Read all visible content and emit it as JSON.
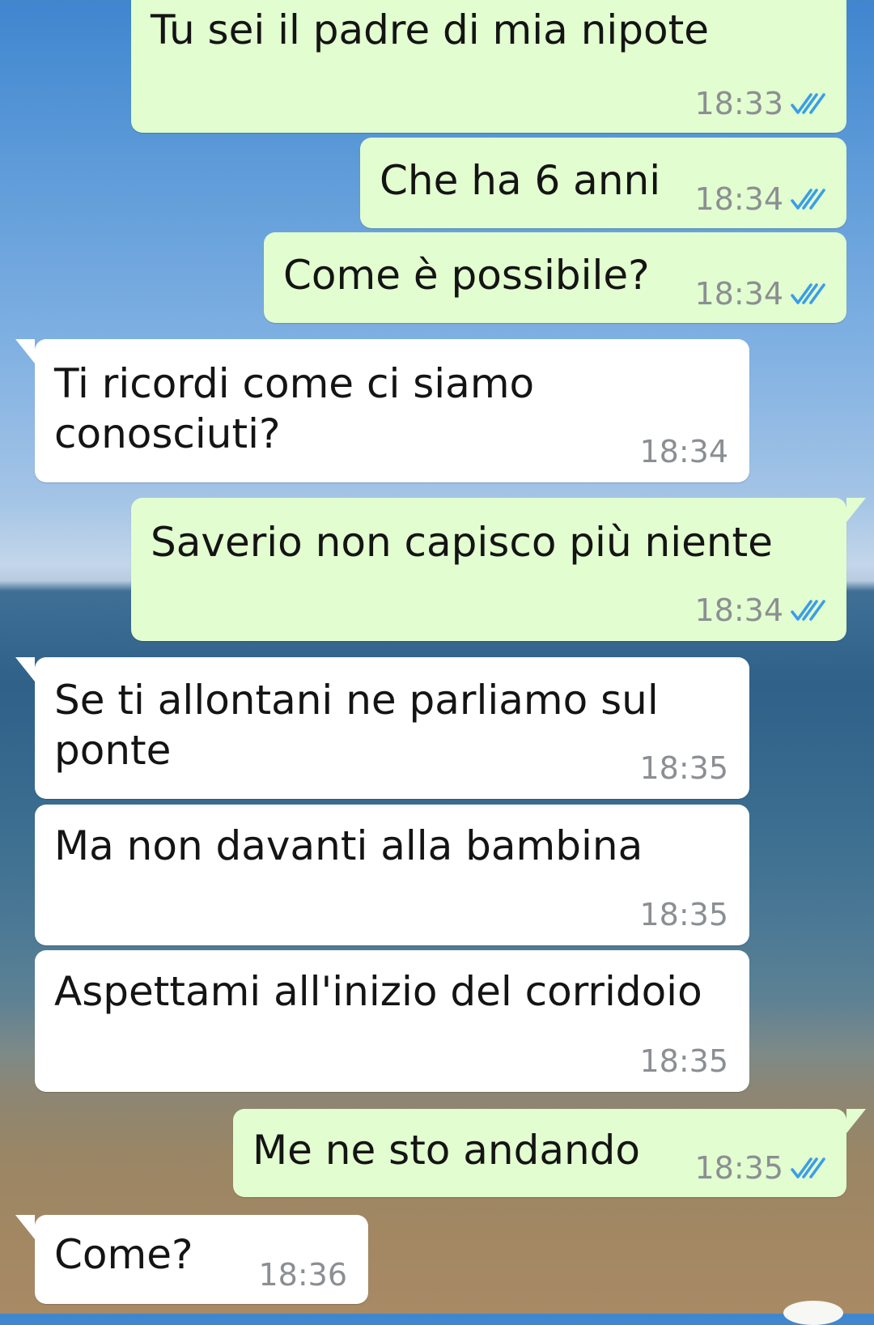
{
  "colors": {
    "outgoing_bubble": "#e2fdcf",
    "incoming_bubble": "#ffffff",
    "time_text": "#8b8f93",
    "read_check": "#3a9ee8"
  },
  "messages": [
    {
      "direction": "out",
      "text": "Tu sei il padre di mia nipote",
      "time": "18:33",
      "status_icon": "double-check-read-icon"
    },
    {
      "direction": "out",
      "text": "Che ha 6 anni",
      "time": "18:34",
      "status_icon": "double-check-read-icon"
    },
    {
      "direction": "out",
      "text": "Come è possibile?",
      "time": "18:34",
      "status_icon": "double-check-read-icon"
    },
    {
      "direction": "in",
      "text": "Ti ricordi come ci siamo\nconosciuti?",
      "time": "18:34"
    },
    {
      "direction": "out",
      "text": "Saverio non capisco più niente",
      "time": "18:34",
      "status_icon": "double-check-read-icon"
    },
    {
      "direction": "in",
      "text": "Se ti allontani ne parliamo sul\nponte",
      "time": "18:35"
    },
    {
      "direction": "in",
      "text": "Ma non davanti alla bambina",
      "time": "18:35"
    },
    {
      "direction": "in",
      "text": "Aspettami all'inizio del corridoio",
      "time": "18:35"
    },
    {
      "direction": "out",
      "text": "Me ne sto andando",
      "time": "18:35",
      "status_icon": "double-check-read-icon"
    },
    {
      "direction": "in",
      "text": "Come?",
      "time": "18:36"
    }
  ]
}
